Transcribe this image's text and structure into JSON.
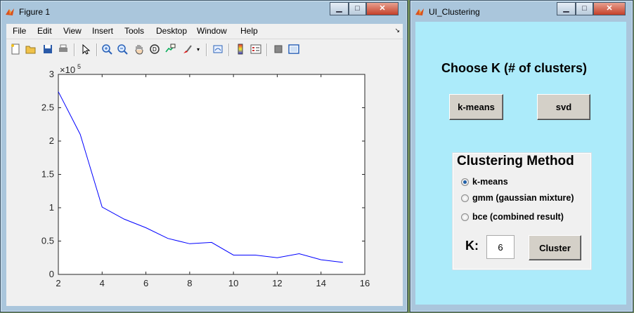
{
  "figure_window": {
    "title": "Figure 1",
    "menu": [
      "File",
      "Edit",
      "View",
      "Insert",
      "Tools",
      "Desktop",
      "Window",
      "Help"
    ],
    "toolbar_icons": [
      "new-figure-icon",
      "open-file-icon",
      "save-icon",
      "print-icon",
      "select-arrow-icon",
      "zoom-in-icon",
      "zoom-out-icon",
      "pan-hand-icon",
      "rotate-3d-icon",
      "data-cursor-icon",
      "brush-icon",
      "link-plot-icon",
      "colorbar-icon",
      "legend-icon",
      "hide-plot-tools-icon",
      "show-plot-tools-icon"
    ],
    "colors": {
      "accent_window": "#aac6dc",
      "line": "#0000ff"
    }
  },
  "chart_data": {
    "type": "line",
    "title": "",
    "xlabel": "",
    "ylabel": "",
    "y_exponent_label": "×10",
    "y_exponent_power": "5",
    "xlim": [
      2,
      16
    ],
    "ylim": [
      0,
      3
    ],
    "xticks": [
      "2",
      "4",
      "6",
      "8",
      "10",
      "12",
      "14",
      "16"
    ],
    "yticks": [
      "0",
      "0.5",
      "1",
      "1.5",
      "2",
      "2.5",
      "3"
    ],
    "grid": false,
    "series": [
      {
        "x": [
          2,
          3,
          4,
          5,
          6,
          7,
          8,
          9,
          10,
          11,
          12,
          13,
          14,
          15
        ],
        "y": [
          2.74,
          2.1,
          1.01,
          0.83,
          0.7,
          0.54,
          0.46,
          0.48,
          0.29,
          0.29,
          0.25,
          0.31,
          0.22,
          0.18
        ]
      }
    ]
  },
  "ui_window": {
    "title": "UI_Clustering",
    "heading": "Choose K (# of clusters)",
    "buttons": {
      "kmeans": "k-means",
      "svd": "svd",
      "cluster": "Cluster"
    },
    "panel": {
      "title": "Clustering Method",
      "options": [
        "k-means",
        "gmm (gaussian mixture)",
        "bce (combined result)"
      ],
      "selected": "k-means"
    },
    "k_label": "K:",
    "k_value": "6",
    "colors": {
      "background": "#acebfa",
      "panel": "#f0f0f0"
    }
  }
}
